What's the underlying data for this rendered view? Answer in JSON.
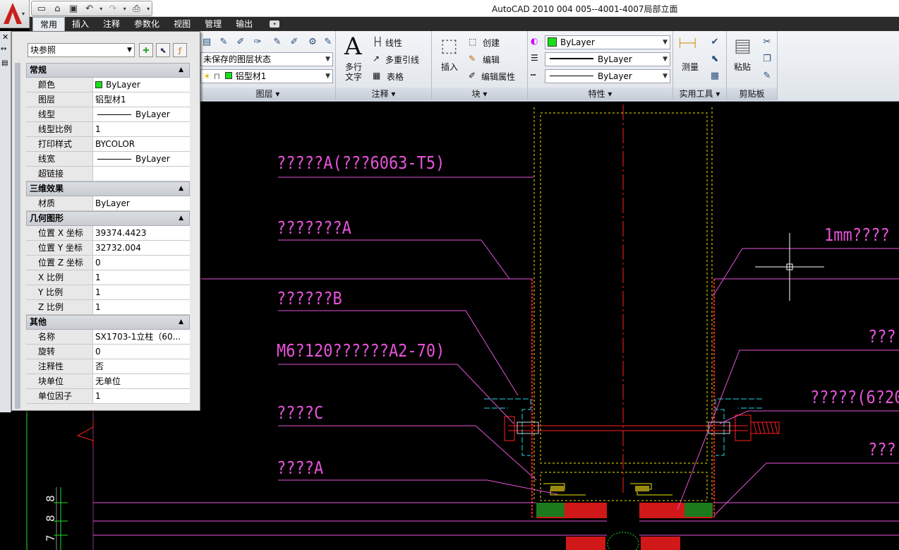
{
  "title": "AutoCAD 2010      004 005--4001-4007局部立面",
  "tabs": [
    "常用",
    "插入",
    "注释",
    "参数化",
    "视图",
    "管理",
    "输出"
  ],
  "ribbon": {
    "layer_state": "未保存的图层状态",
    "current_layer": "铝型材1",
    "panels": {
      "layers": "图层 ▾",
      "annotation": "注释 ▾",
      "block": "块 ▾",
      "properties": "特性 ▾",
      "utilities": "实用工具 ▾",
      "clipboard": "剪贴板"
    },
    "mtext_l1": "多行",
    "mtext_l2": "文字",
    "linear": "线性",
    "multileader": "多重引线",
    "table": "表格",
    "insert": "插入",
    "create": "创建",
    "edit": "编辑",
    "edit_attr": "编辑属性",
    "color": "ByLayer",
    "linetype": "ByLayer",
    "lineweight": "ByLayer",
    "measure": "测量",
    "paste": "粘贴"
  },
  "properties": {
    "object_type": "块参照",
    "sections": [
      {
        "title": "常规",
        "rows": [
          {
            "k": "颜色",
            "v": "ByLayer",
            "kind": "color"
          },
          {
            "k": "图层",
            "v": "铝型材1"
          },
          {
            "k": "线型",
            "v": "ByLayer",
            "kind": "line"
          },
          {
            "k": "线型比例",
            "v": "1"
          },
          {
            "k": "打印样式",
            "v": "BYCOLOR"
          },
          {
            "k": "线宽",
            "v": "ByLayer",
            "kind": "line"
          },
          {
            "k": "超链接",
            "v": ""
          }
        ]
      },
      {
        "title": "三维效果",
        "rows": [
          {
            "k": "材质",
            "v": "ByLayer"
          }
        ]
      },
      {
        "title": "几何图形",
        "rows": [
          {
            "k": "位置 X 坐标",
            "v": "39374.4423"
          },
          {
            "k": "位置 Y 坐标",
            "v": "32732.004"
          },
          {
            "k": "位置 Z 坐标",
            "v": "0"
          },
          {
            "k": "X 比例",
            "v": "1"
          },
          {
            "k": "Y 比例",
            "v": "1"
          },
          {
            "k": "Z 比例",
            "v": "1"
          }
        ]
      },
      {
        "title": "其他",
        "rows": [
          {
            "k": "名称",
            "v": "SX1703-1立柱（60..."
          },
          {
            "k": "旋转",
            "v": "0"
          },
          {
            "k": "注释性",
            "v": "否"
          },
          {
            "k": "块单位",
            "v": "无单位"
          },
          {
            "k": "单位因子",
            "v": "1"
          }
        ]
      }
    ]
  },
  "drawing": {
    "labels": [
      "?????A(???6063-T5)",
      "???????A",
      "??????B",
      "M6?120??????A2-70)",
      "????C",
      "????A",
      "1mm????",
      "???",
      "?????(6?20",
      "???"
    ],
    "dims": [
      "8",
      "8",
      "7"
    ]
  },
  "colors": {
    "label": "#e653d8",
    "yellow": "#e8e800",
    "red": "#ff2020",
    "cyan": "#20d8e8",
    "green": "#20e020"
  }
}
